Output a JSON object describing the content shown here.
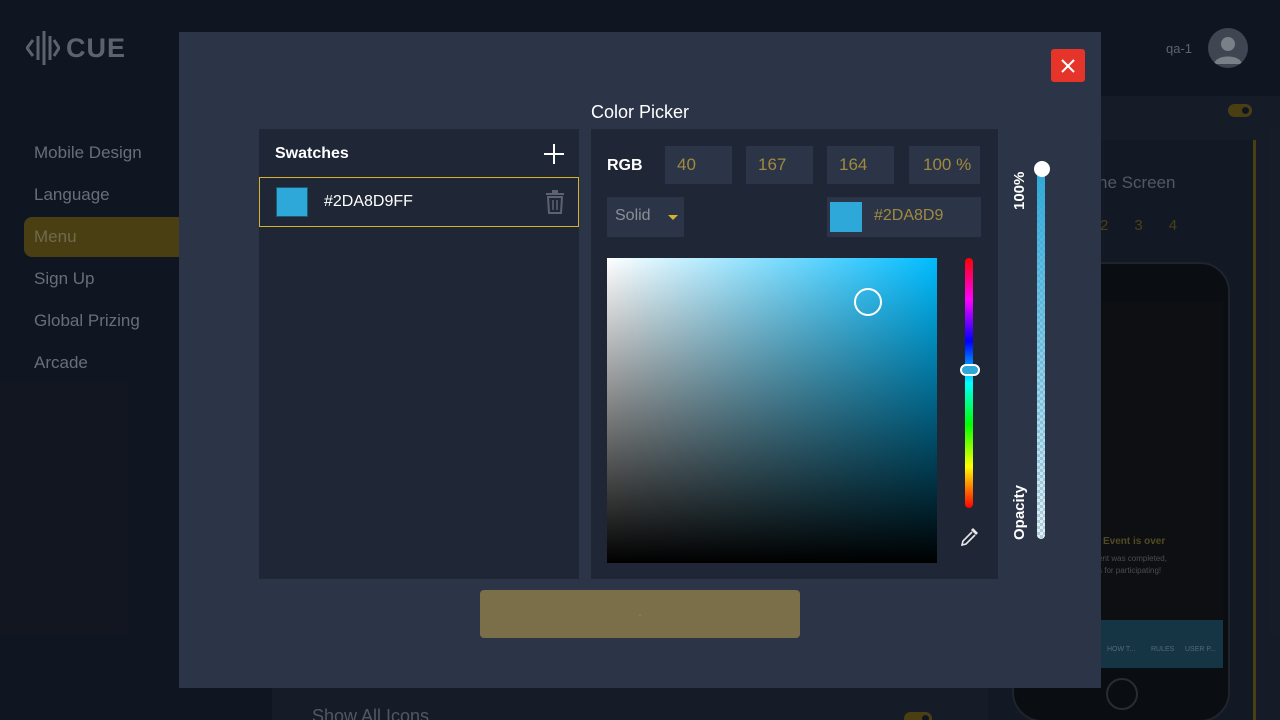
{
  "app": {
    "logo_text": "CUE",
    "user_name": "qa-1"
  },
  "sidebar": {
    "items": [
      {
        "label": "Mobile Design"
      },
      {
        "label": "Language"
      },
      {
        "label": "Menu"
      },
      {
        "label": "Sign Up"
      },
      {
        "label": "Global Prizing"
      },
      {
        "label": "Arcade"
      }
    ]
  },
  "background": {
    "preview_title": "ne Screen",
    "pages": [
      "2",
      "3",
      "4"
    ],
    "show_all_icons_label": "Show All Icons",
    "phone": {
      "event_title": "Event is over",
      "event_line1": "ent was completed,",
      "event_line2": "s for participating!",
      "nav": [
        "HOW T...",
        "RULES",
        "USER P..."
      ]
    }
  },
  "modal": {
    "title": "Color Picker",
    "swatches": {
      "title": "Swatches",
      "items": [
        {
          "hex": "#2DA8D9FF",
          "color": "#2da8d9"
        }
      ]
    },
    "picker": {
      "mode_label": "RGB",
      "r": "40",
      "g": "167",
      "b": "164",
      "alpha": "100 %",
      "fill_type": "Solid",
      "hex_value": "#2DA8D9",
      "current_color": "#2da8d9",
      "opacity_value_label": "100%",
      "opacity_title": "Opacity"
    },
    "apply_label": "."
  },
  "icons": {
    "close": "close-icon",
    "add": "plus-icon",
    "delete": "trash-icon",
    "eyedropper": "eyedropper-icon",
    "dropdown": "caret-down-icon"
  },
  "colors": {
    "accent": "#d6b12f",
    "close": "#e5352a",
    "selected": "#2da8d9"
  }
}
